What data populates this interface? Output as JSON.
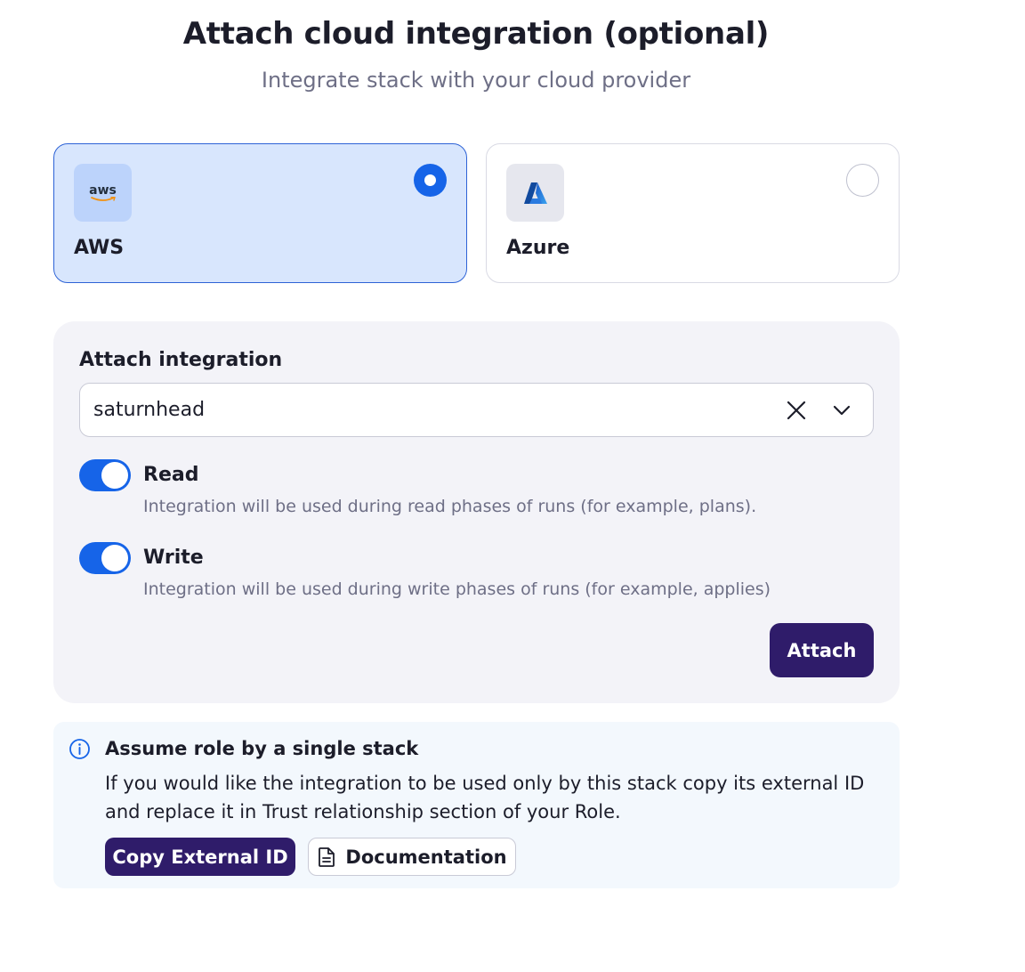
{
  "header": {
    "title": "Attach cloud integration (optional)",
    "subtitle": "Integrate stack with your cloud provider"
  },
  "providers": [
    {
      "name": "AWS",
      "logo_text": "aws",
      "icon": "aws-logo-icon",
      "selected": true
    },
    {
      "name": "Azure",
      "icon": "azure-logo-icon",
      "selected": false
    }
  ],
  "integration": {
    "label": "Attach integration",
    "selected_value": "saturnhead",
    "read": {
      "title": "Read",
      "description": "Integration will be used during read phases of runs (for example, plans).",
      "enabled": true
    },
    "write": {
      "title": "Write",
      "description": "Integration will be used during write phases of runs (for example, applies)",
      "enabled": true
    },
    "attach_label": "Attach"
  },
  "info": {
    "title": "Assume role by a single stack",
    "text": "If you would like the integration to be used only by this stack copy its external ID and replace it in Trust relationship section of your Role.",
    "copy_label": "Copy External ID",
    "doc_label": "Documentation"
  },
  "colors": {
    "primary_blue": "#1664e8",
    "dark_purple": "#2f1c6a",
    "selected_card_bg": "#d8e6fd"
  }
}
